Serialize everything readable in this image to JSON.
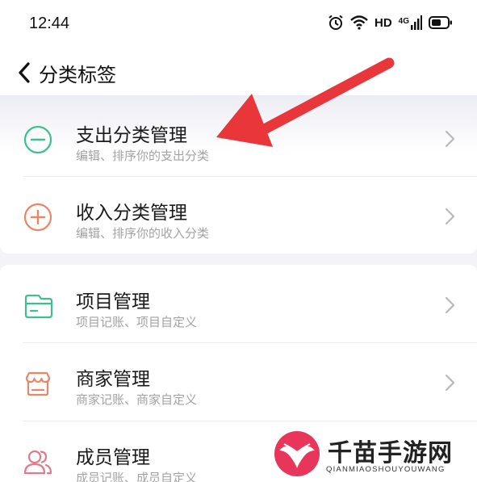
{
  "status_bar": {
    "time": "12:44",
    "network_label": "HD",
    "signal_label": "4G"
  },
  "nav": {
    "title": "分类标签"
  },
  "sections": [
    {
      "items": [
        {
          "title": "支出分类管理",
          "subtitle": "编辑、排序你的支出分类",
          "icon": "minus-circle-icon",
          "color": "#3fbf8f"
        },
        {
          "title": "收入分类管理",
          "subtitle": "编辑、排序你的收入分类",
          "icon": "plus-circle-icon",
          "color": "#e8866a"
        }
      ]
    },
    {
      "items": [
        {
          "title": "项目管理",
          "subtitle": "项目记账、项目自定义",
          "icon": "folder-card-icon",
          "color": "#3fbf8f"
        },
        {
          "title": "商家管理",
          "subtitle": "商家记账、商家自定义",
          "icon": "store-icon",
          "color": "#e8866a"
        },
        {
          "title": "成员管理",
          "subtitle": "成员记账、成员自定义",
          "icon": "members-icon",
          "color": "#e07a8f"
        }
      ]
    }
  ],
  "annotation": {
    "arrow_color": "#e8363a"
  },
  "watermark": {
    "name": "千苗手游网",
    "url_text": "QIANMIAOSHOUYOUWANG",
    "color": "#e8365a"
  }
}
